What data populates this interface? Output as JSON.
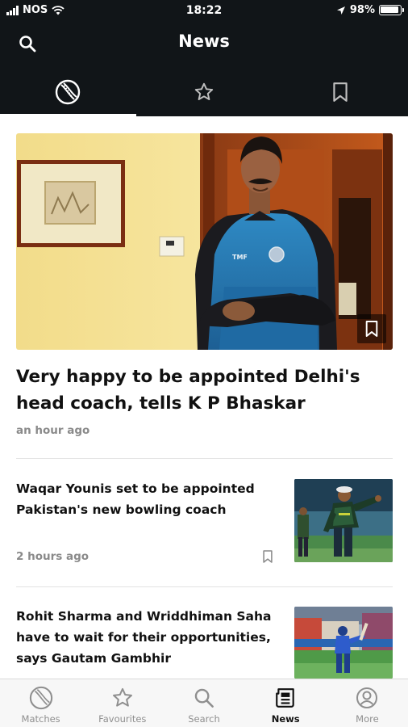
{
  "status_bar": {
    "carrier": "NOS",
    "time": "18:22",
    "battery": "98%"
  },
  "header": {
    "title": "News",
    "tabs": [
      {
        "icon": "cricket-ball-icon",
        "active": true
      },
      {
        "icon": "star-icon",
        "active": false
      },
      {
        "icon": "bookmark-icon",
        "active": false
      }
    ]
  },
  "featured": {
    "title": "Very happy to be appointed Delhi's head coach, tells K P Bhaskar",
    "time": "an hour ago",
    "jersey_text": "TMF"
  },
  "articles": [
    {
      "title": "Waqar Younis set to be appointed Pakistan's new bowling coach",
      "time": "2 hours ago"
    },
    {
      "title": "Rohit Sharma and Wriddhiman Saha have to wait for their opportunities, says Gautam Gambhir",
      "time": ""
    }
  ],
  "bottom_nav": [
    {
      "label": "Matches",
      "icon": "cricket-ball-icon",
      "active": false
    },
    {
      "label": "Favourites",
      "icon": "star-icon",
      "active": false
    },
    {
      "label": "Search",
      "icon": "search-icon",
      "active": false
    },
    {
      "label": "News",
      "icon": "newspaper-icon",
      "active": true
    },
    {
      "label": "More",
      "icon": "profile-icon",
      "active": false
    }
  ],
  "colors": {
    "header_bg": "#111518",
    "active_text": "#111111",
    "inactive_text": "#8f8f8f"
  }
}
